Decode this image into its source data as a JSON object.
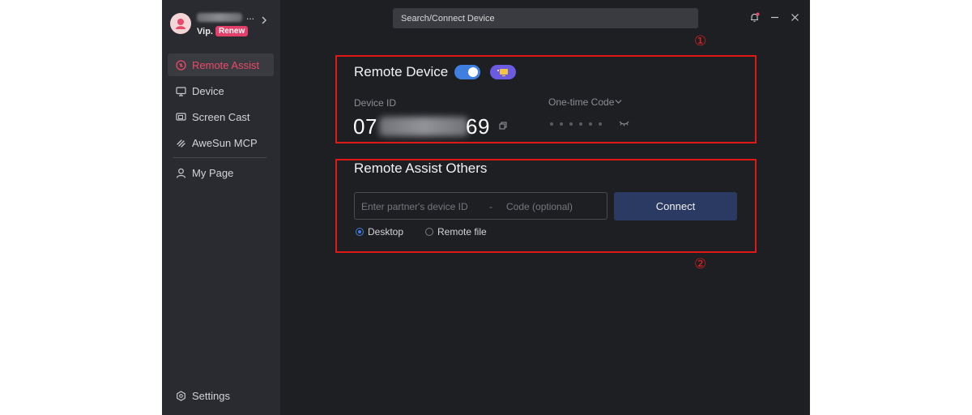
{
  "sidebar": {
    "user": {
      "name_suffix": "...",
      "tier": "Vip.",
      "renew_label": "Renew"
    },
    "items": [
      {
        "label": "Remote Assist",
        "icon": "remote-assist-icon",
        "active": true
      },
      {
        "label": "Device",
        "icon": "monitor-icon",
        "active": false
      },
      {
        "label": "Screen Cast",
        "icon": "screen-cast-icon",
        "active": false
      },
      {
        "label": "AweSun MCP",
        "icon": "mcp-icon",
        "active": false
      },
      {
        "label": "My Page",
        "icon": "user-icon",
        "active": false
      }
    ],
    "settings_label": "Settings"
  },
  "header": {
    "search_placeholder": "Search/Connect Device"
  },
  "annotations": {
    "box1": "①",
    "box2": "②"
  },
  "remote_device": {
    "title": "Remote Device",
    "toggle_on": true,
    "device_id_label": "Device ID",
    "device_id_prefix": "07",
    "device_id_suffix": "69",
    "otp_label": "One-time Code"
  },
  "assist_others": {
    "title": "Remote Assist Others",
    "partner_placeholder": "Enter partner's device ID",
    "separator": "-",
    "code_placeholder": "Code (optional)",
    "connect_label": "Connect",
    "mode_options": [
      {
        "label": "Desktop",
        "selected": true
      },
      {
        "label": "Remote file",
        "selected": false
      }
    ]
  },
  "colors": {
    "accent_pink": "#e94a6a",
    "accent_blue": "#3f7fe0",
    "annotation_red": "#e01818"
  }
}
